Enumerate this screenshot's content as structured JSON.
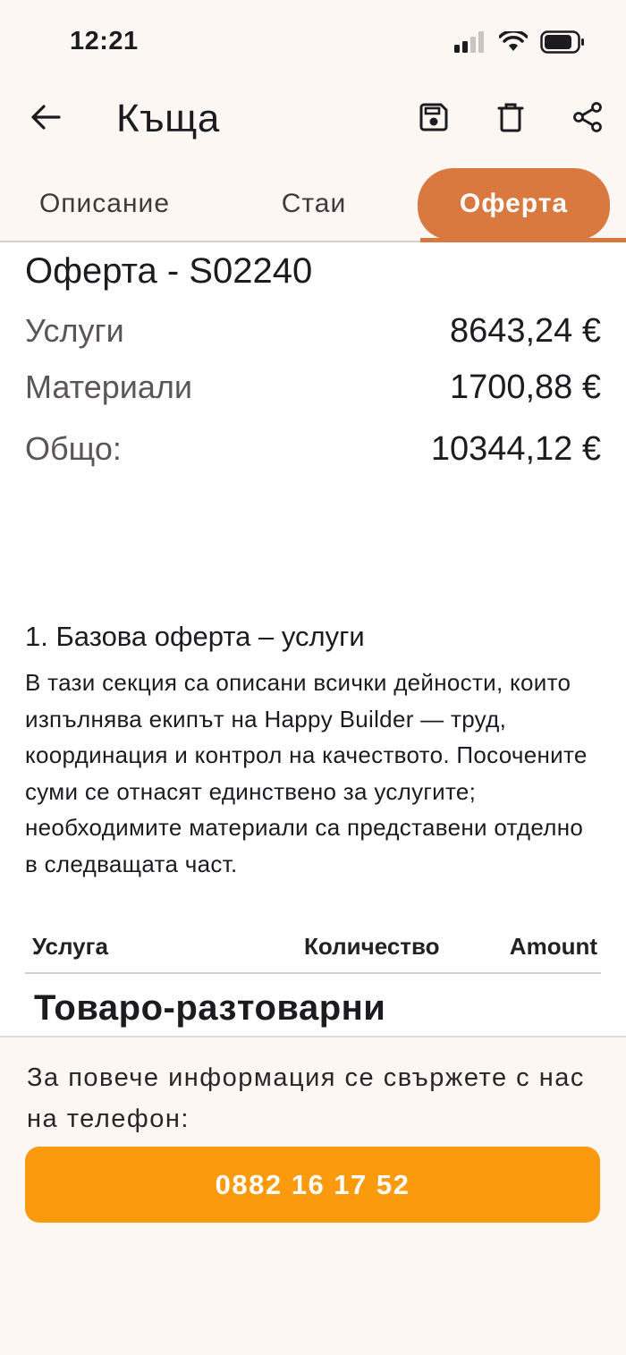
{
  "status_bar": {
    "time": "12:21",
    "icons": [
      "cellular-signal-icon",
      "wifi-icon",
      "battery-icon"
    ]
  },
  "app_bar": {
    "title": "Къща",
    "icons": [
      "arrow-back-icon",
      "save-icon",
      "delete-icon",
      "share-icon"
    ]
  },
  "tabs": [
    {
      "label": "Описание",
      "active": false
    },
    {
      "label": "Стаи",
      "active": false
    },
    {
      "label": "Оферта",
      "active": true
    }
  ],
  "offer": {
    "title": "Оферта - S02240",
    "summary": [
      {
        "label": "Услуги",
        "value": "8643,24 €"
      },
      {
        "label": "Материали",
        "value": "1700,88 €"
      },
      {
        "label": "Общо:",
        "value": "10344,12 €"
      }
    ]
  },
  "section": {
    "title": "1. Базова оферта – услуги",
    "text": "В тази секция са описани всички дейности, които изпълнява екипът на Happy Builder — труд, координация и контрол на качеството. Посочените суми се отнасят единствено за услугите; необходимите материали са представени отделно в следващата част."
  },
  "table": {
    "headers": [
      "Услуга",
      "Количество",
      "Amount"
    ],
    "group_title": "Товаро-разтоварни"
  },
  "contact": {
    "text": "За повече информация се свържете с нас на телефон:",
    "phone": "0882 16 17 52"
  },
  "colors": {
    "background": "#FDF7F3",
    "accent": "#D9793F",
    "phone_button": "#FB9A0C"
  }
}
